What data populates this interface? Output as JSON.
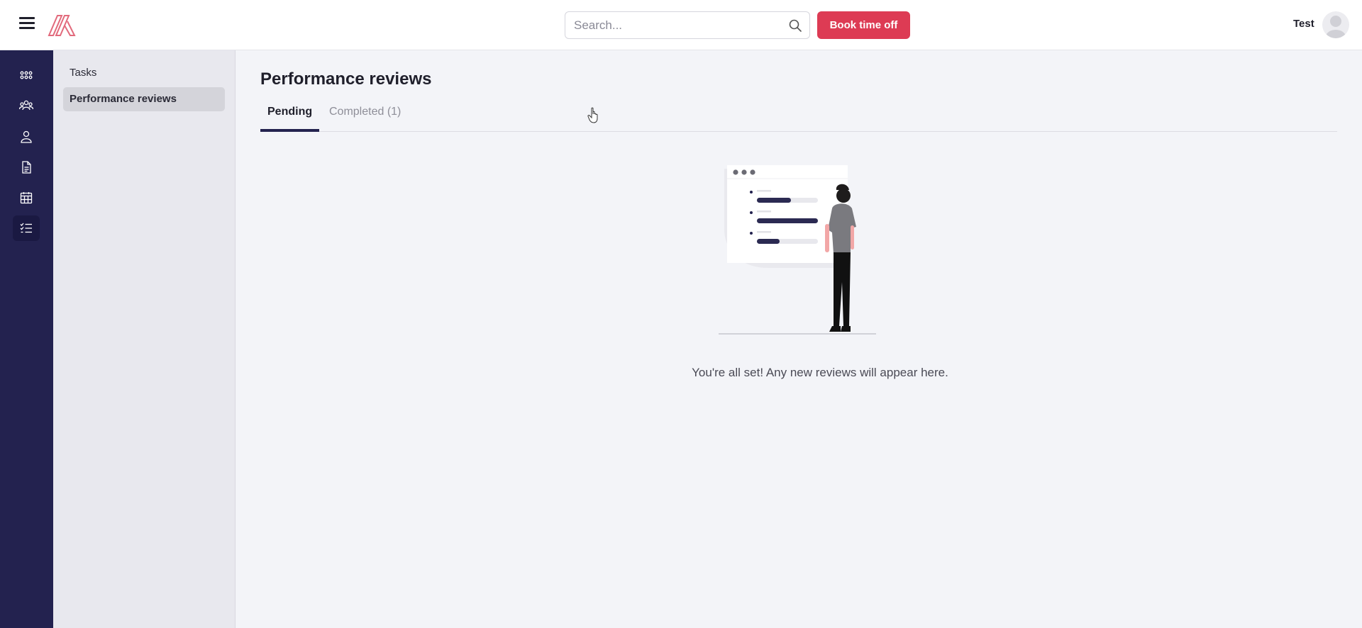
{
  "topbar": {
    "search_placeholder": "Search...",
    "book_button_label": "Book time off",
    "user_name": "Test"
  },
  "rail": {
    "items": [
      {
        "icon": "apps-grid-icon"
      },
      {
        "icon": "team-icon"
      },
      {
        "icon": "person-icon"
      },
      {
        "icon": "document-icon"
      },
      {
        "icon": "calendar-icon"
      },
      {
        "icon": "checklist-icon",
        "active": true
      }
    ]
  },
  "subnav": {
    "items": [
      {
        "label": "Tasks"
      },
      {
        "label": "Performance reviews",
        "active": true
      }
    ]
  },
  "main": {
    "title": "Performance reviews",
    "tabs": [
      {
        "label": "Pending",
        "active": true
      },
      {
        "label": "Completed (1)"
      }
    ],
    "empty_message": "You're all set! Any new reviews will appear here."
  },
  "colors": {
    "accent": "#dd3b54",
    "rail_background": "#23224f",
    "page_background": "#f3f4f8"
  }
}
